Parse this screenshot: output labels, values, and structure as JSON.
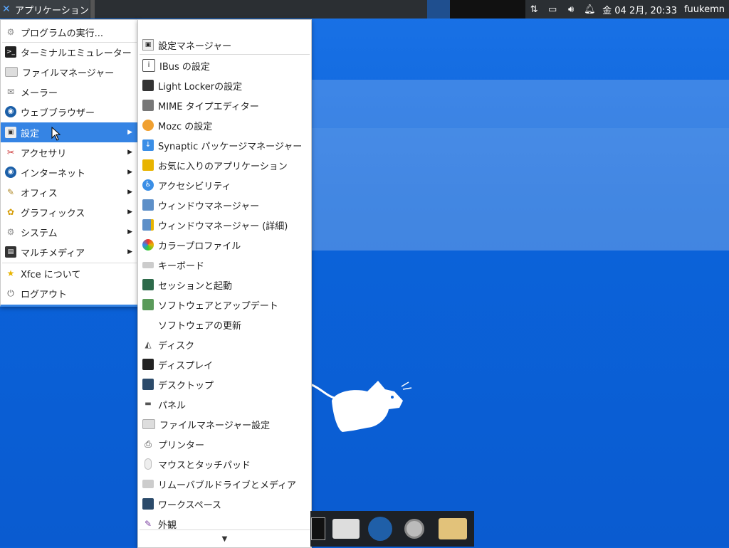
{
  "top_panel": {
    "applications_label": "アプリケーション",
    "clock": "金 04  2月, 20:33",
    "user": "fuukemn"
  },
  "main_menu": {
    "items": [
      {
        "label": "プログラムの実行...",
        "icon": "run-icon"
      },
      {
        "label": "ターミナルエミュレーター",
        "icon": "terminal-icon"
      },
      {
        "label": "ファイルマネージャー",
        "icon": "folder-icon"
      },
      {
        "label": "メーラー",
        "icon": "mail-icon"
      },
      {
        "label": "ウェブブラウザー",
        "icon": "browser-icon"
      },
      {
        "label": "設定",
        "icon": "settings-icon",
        "submenu": true,
        "selected": true
      },
      {
        "label": "アクセサリ",
        "icon": "accessories-icon",
        "submenu": true
      },
      {
        "label": "インターネット",
        "icon": "internet-icon",
        "submenu": true
      },
      {
        "label": "オフィス",
        "icon": "office-icon",
        "submenu": true
      },
      {
        "label": "グラフィックス",
        "icon": "graphics-icon",
        "submenu": true
      },
      {
        "label": "システム",
        "icon": "system-icon",
        "submenu": true
      },
      {
        "label": "マルチメディア",
        "icon": "multimedia-icon",
        "submenu": true
      },
      {
        "label": "Xfce について",
        "icon": "star-icon"
      },
      {
        "label": "ログアウト",
        "icon": "power-icon"
      }
    ]
  },
  "settings_menu": {
    "header": "設定マネージャー",
    "items": [
      "IBus の設定",
      "Light Lockerの設定",
      "MIME タイプエディター",
      "Mozc の設定",
      "Synaptic パッケージマネージャー",
      "お気に入りのアプリケーション",
      "アクセシビリティ",
      "ウィンドウマネージャー",
      "ウィンドウマネージャー (詳細)",
      "カラープロファイル",
      "キーボード",
      "セッションと起動",
      "ソフトウェアとアップデート",
      "ソフトウェアの更新",
      "ディスク",
      "ディスプレイ",
      "デスクトップ",
      "パネル",
      "ファイルマネージャー設定",
      "プリンター",
      "マウスとタッチパッド",
      "リムーバブルドライブとメディア",
      "ワークスペース",
      "外観"
    ]
  },
  "colors": {
    "accent": "#3584e4",
    "panel": "#2b2f33",
    "desktop": "#0b63da"
  }
}
